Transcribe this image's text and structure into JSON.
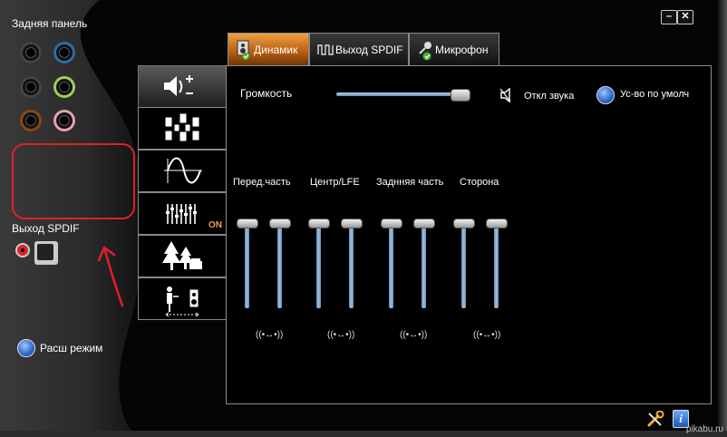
{
  "window": {
    "minimize_label": "–",
    "close_label": "✕"
  },
  "left": {
    "rear_panel_label": "Задняя панель",
    "spdif_out_label": "Выход SPDIF",
    "advanced_mode_label": "Расш режим"
  },
  "tabs": [
    {
      "label": "Динамик",
      "icon": "speaker-icon",
      "active": true
    },
    {
      "label": "Выход SPDIF",
      "icon": "spdif-wave-icon",
      "active": false
    },
    {
      "label": "Микрофон",
      "icon": "microphone-icon",
      "active": false
    }
  ],
  "side_buttons": [
    {
      "name": "volume-settings",
      "icon": "speaker-volume-icon"
    },
    {
      "name": "speaker-config",
      "icon": "speaker-array-icon"
    },
    {
      "name": "sound-effects",
      "icon": "sine-wave-icon"
    },
    {
      "name": "equalizer",
      "icon": "equalizer-icon",
      "badge": "ON"
    },
    {
      "name": "environment",
      "icon": "environment-trees-icon"
    },
    {
      "name": "room-correction",
      "icon": "room-correction-icon"
    }
  ],
  "main": {
    "volume_label": "Громкость",
    "volume_level": 0.95,
    "mute_label": "Откл звука",
    "default_device_label": "Ус-во по умолч",
    "channel_groups": [
      {
        "label": "Перед.часть",
        "levels": [
          1.0,
          1.0
        ]
      },
      {
        "label": "Центр/LFE",
        "levels": [
          1.0,
          1.0
        ]
      },
      {
        "label": "Заднняя часть",
        "levels": [
          1.0,
          1.0
        ]
      },
      {
        "label": "Сторона",
        "levels": [
          1.0,
          1.0
        ]
      }
    ],
    "link_icon_label": "((•↔•))"
  },
  "footer": {
    "watermark": "pikabu.ru"
  },
  "colors": {
    "accent_orange": "#e08a2a",
    "slider_blue": "#8fb6dc",
    "annotation_red": "#e0202a",
    "eq_on_orange": "#f0a040"
  }
}
